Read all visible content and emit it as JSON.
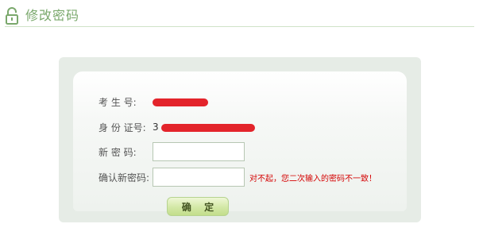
{
  "header": {
    "title": "修改密码",
    "icon": "unlock-icon"
  },
  "form": {
    "exam_number": {
      "label": "考 生 号:",
      "value_prefix": ""
    },
    "id_number": {
      "label": "身 份 证号:",
      "value_prefix": "3"
    },
    "new_password": {
      "label": "新   密   码:",
      "value": "",
      "placeholder": ""
    },
    "confirm_password": {
      "label": "确认新密码:",
      "value": "",
      "placeholder": "",
      "error": "对不起，您二次输入的密码不一致！"
    },
    "submit_label": "确 定"
  },
  "colors": {
    "accent": "#7aa86c",
    "error": "#d40000",
    "redaction": "#e3242b",
    "panel": "#e6ece6"
  }
}
